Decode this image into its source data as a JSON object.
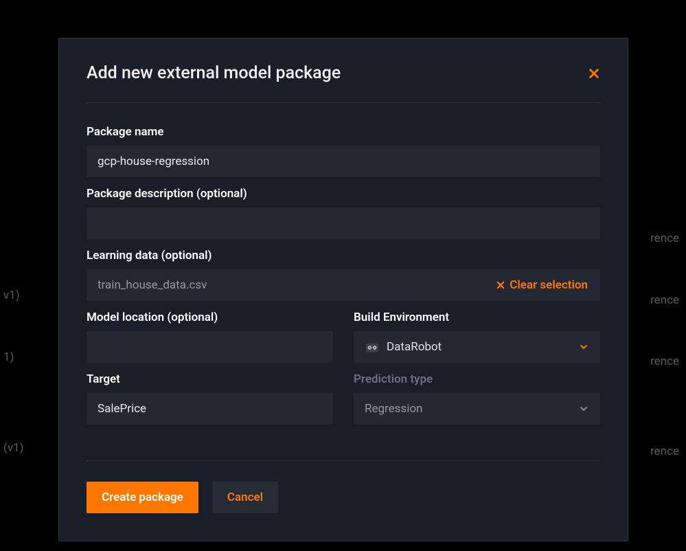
{
  "modal": {
    "title": "Add new external model package"
  },
  "fields": {
    "package_name": {
      "label": "Package name",
      "value": "gcp-house-regression"
    },
    "package_description": {
      "label": "Package description (optional)",
      "value": ""
    },
    "learning_data": {
      "label": "Learning data (optional)",
      "file_name": "train_house_data.csv",
      "clear_label": "Clear selection"
    },
    "model_location": {
      "label": "Model location (optional)",
      "value": ""
    },
    "target": {
      "label": "Target",
      "value": "SalePrice"
    },
    "build_env": {
      "label": "Build Environment",
      "selected": "DataRobot"
    },
    "prediction_type": {
      "label": "Prediction type",
      "selected": "Regression"
    }
  },
  "buttons": {
    "create": "Create package",
    "cancel": "Cancel"
  },
  "background": {
    "ref": "rence",
    "v1a": "v1)",
    "v1b": "1)",
    "v1c": " (v1)"
  },
  "colors": {
    "accent": "#ff7700",
    "panel": "#191f28",
    "input": "#232833"
  }
}
